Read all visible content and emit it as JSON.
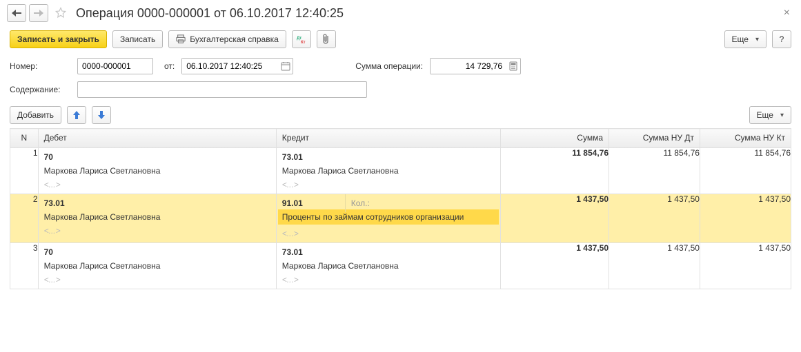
{
  "title": "Операция 0000-000001 от 06.10.2017 12:40:25",
  "toolbar": {
    "save_close": "Записать и закрыть",
    "save": "Записать",
    "accounting_ref": "Бухгалтерская справка",
    "more": "Еще"
  },
  "form": {
    "number_label": "Номер:",
    "number_value": "0000-000001",
    "from_label": "от:",
    "date_value": "06.10.2017 12:40:25",
    "sum_label": "Сумма операции:",
    "sum_value": "14 729,76",
    "content_label": "Содержание:",
    "content_value": ""
  },
  "grid_toolbar": {
    "add": "Добавить",
    "more": "Еще"
  },
  "columns": {
    "n": "N",
    "debit": "Дебет",
    "credit": "Кредит",
    "sum": "Сумма",
    "nu_dt": "Сумма НУ Дт",
    "nu_kt": "Сумма НУ Кт"
  },
  "kol_label": "Кол.:",
  "placeholder_ellipsis": "<...>",
  "rows": [
    {
      "n": "1",
      "debit_account": "70",
      "debit_subconto": "Маркова Лариса Светлановна",
      "credit_account": "73.01",
      "credit_subconto": "Маркова Лариса Светлановна",
      "sum": "11 854,76",
      "nu_dt": "11 854,76",
      "nu_kt": "11 854,76"
    },
    {
      "n": "2",
      "debit_account": "73.01",
      "debit_subconto": "Маркова Лариса Светлановна",
      "credit_account": "91.01",
      "credit_subconto": "Проценты по займам сотрудников организации",
      "sum": "1 437,50",
      "nu_dt": "1 437,50",
      "nu_kt": "1 437,50",
      "selected": true
    },
    {
      "n": "3",
      "debit_account": "70",
      "debit_subconto": "Маркова Лариса Светлановна",
      "credit_account": "73.01",
      "credit_subconto": "Маркова Лариса Светлановна",
      "sum": "1 437,50",
      "nu_dt": "1 437,50",
      "nu_kt": "1 437,50"
    }
  ]
}
